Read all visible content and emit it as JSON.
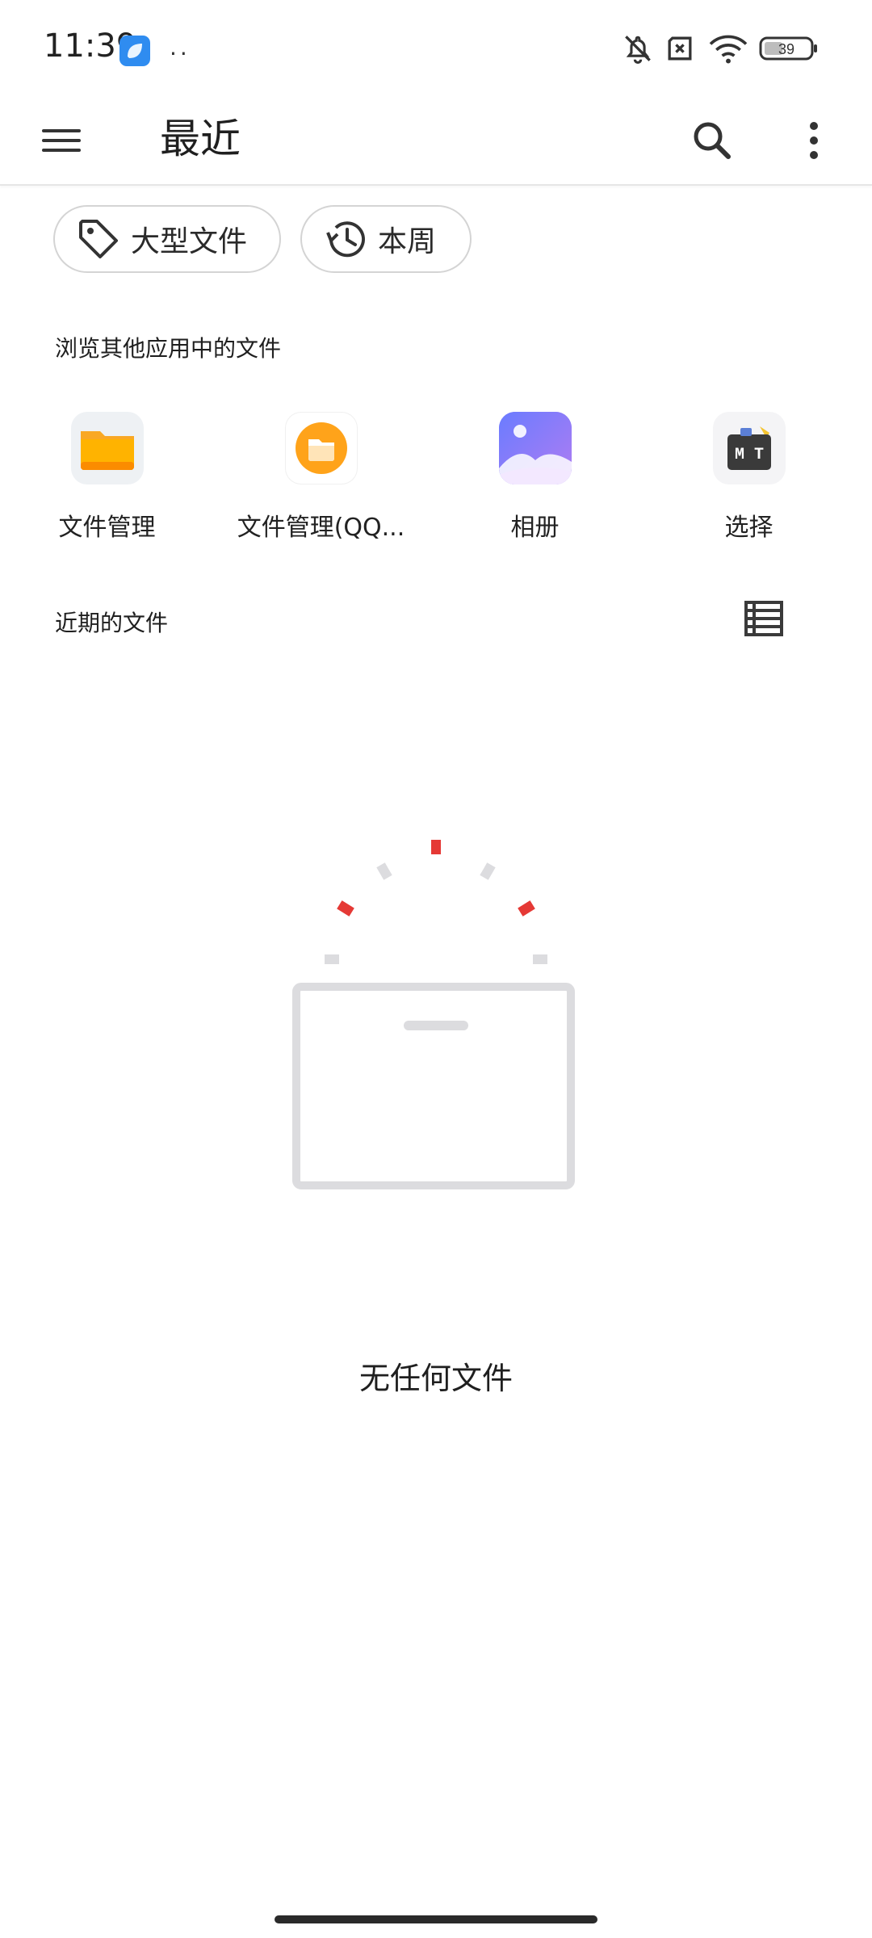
{
  "status_bar": {
    "time": "11:39",
    "dots": "··",
    "battery": "39",
    "app_icon": "blue-app-icon",
    "icons": [
      "bell-off-icon",
      "sim-x-icon",
      "wifi-icon",
      "battery-icon"
    ]
  },
  "app_bar": {
    "title": "最近",
    "menu_icon": "hamburger-menu-icon",
    "search_icon": "search-icon",
    "more_icon": "more-vert-icon"
  },
  "chips": [
    {
      "label": "大型文件",
      "icon": "tag-icon"
    },
    {
      "label": "本周",
      "icon": "history-icon"
    }
  ],
  "browse_section": {
    "title": "浏览其他应用中的文件",
    "apps": [
      {
        "label": "文件管理",
        "icon": "folder-app-icon"
      },
      {
        "label": "文件管理(QQ...",
        "icon": "qq-files-app-icon"
      },
      {
        "label": "相册",
        "icon": "gallery-app-icon"
      },
      {
        "label": "选择",
        "icon": "mt-app-icon"
      }
    ]
  },
  "recent_section": {
    "title": "近期的文件",
    "view_toggle_icon": "list-view-icon"
  },
  "empty_state": {
    "text": "无任何文件",
    "illustration": "empty-box-illustration"
  },
  "colors": {
    "accent_red": "#e53935",
    "chip_border": "#d4d4d4",
    "illustration_gray": "#dcdcdf"
  }
}
